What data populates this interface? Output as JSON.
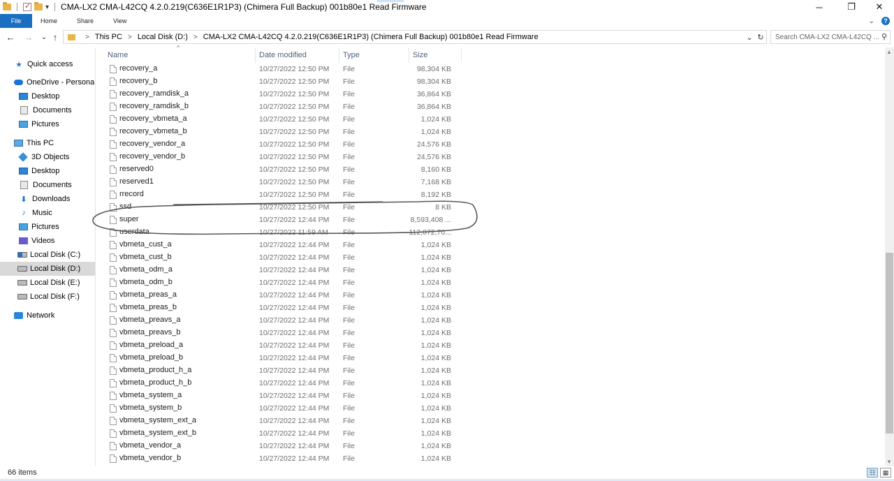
{
  "window": {
    "title": "CMA-LX2 CMA-L42CQ 4.2.0.219(C636E1R1P3) (Chimera Full Backup) 001b80e1 Read Firmware",
    "qat_dropdown": "▾",
    "minimize": "─",
    "restore": "❐",
    "close": "✕"
  },
  "ribbon": {
    "tabs": [
      "File",
      "Home",
      "Share",
      "View"
    ],
    "expand": "⌄",
    "help": "?"
  },
  "nav": {
    "back": "←",
    "forward": "→",
    "recent": "⌄",
    "up": "↑",
    "breadcrumbs": [
      "This PC",
      "Local Disk (D:)",
      "CMA-LX2 CMA-L42CQ 4.2.0.219(C636E1R1P3) (Chimera Full Backup) 001b80e1 Read Firmware"
    ],
    "crumb_sep": ">",
    "dropdown": "⌄",
    "refresh": "↻",
    "search_placeholder": "Search CMA-LX2 CMA-L42CQ ...",
    "search_icon": "⚲"
  },
  "sidebar": {
    "items": [
      {
        "label": "Quick access",
        "icon": "star-icon"
      },
      {
        "label": "OneDrive - Personal",
        "icon": "cloud-icon"
      },
      {
        "label": "Desktop",
        "icon": "desktop-icon"
      },
      {
        "label": "Documents",
        "icon": "documents-icon"
      },
      {
        "label": "Pictures",
        "icon": "pictures-icon"
      },
      {
        "label": "This PC",
        "icon": "computer-icon"
      },
      {
        "label": "3D Objects",
        "icon": "cube-icon"
      },
      {
        "label": "Desktop",
        "icon": "desktop-icon"
      },
      {
        "label": "Documents",
        "icon": "documents-icon"
      },
      {
        "label": "Downloads",
        "icon": "download-icon"
      },
      {
        "label": "Music",
        "icon": "music-icon"
      },
      {
        "label": "Pictures",
        "icon": "pictures-icon"
      },
      {
        "label": "Videos",
        "icon": "videos-icon"
      },
      {
        "label": "Local Disk (C:)",
        "icon": "drive-icon"
      },
      {
        "label": "Local Disk (D:)",
        "icon": "drive-icon"
      },
      {
        "label": "Local Disk (E:)",
        "icon": "drive-icon"
      },
      {
        "label": "Local Disk (F:)",
        "icon": "drive-icon"
      },
      {
        "label": "Network",
        "icon": "network-icon"
      }
    ],
    "selected": "Local Disk (D:)",
    "glyphs": {
      "star": "★",
      "down": "⬇",
      "music": "♪"
    }
  },
  "columns": {
    "name": "Name",
    "date": "Date modified",
    "type": "Type",
    "size": "Size",
    "sort_indicator": "^"
  },
  "files": [
    {
      "name": "recovery_a",
      "date": "10/27/2022 12:50 PM",
      "type": "File",
      "size": "98,304 KB"
    },
    {
      "name": "recovery_b",
      "date": "10/27/2022 12:50 PM",
      "type": "File",
      "size": "98,304 KB"
    },
    {
      "name": "recovery_ramdisk_a",
      "date": "10/27/2022 12:50 PM",
      "type": "File",
      "size": "36,864 KB"
    },
    {
      "name": "recovery_ramdisk_b",
      "date": "10/27/2022 12:50 PM",
      "type": "File",
      "size": "36,864 KB"
    },
    {
      "name": "recovery_vbmeta_a",
      "date": "10/27/2022 12:50 PM",
      "type": "File",
      "size": "1,024 KB"
    },
    {
      "name": "recovery_vbmeta_b",
      "date": "10/27/2022 12:50 PM",
      "type": "File",
      "size": "1,024 KB"
    },
    {
      "name": "recovery_vendor_a",
      "date": "10/27/2022 12:50 PM",
      "type": "File",
      "size": "24,576 KB"
    },
    {
      "name": "recovery_vendor_b",
      "date": "10/27/2022 12:50 PM",
      "type": "File",
      "size": "24,576 KB"
    },
    {
      "name": "reserved0",
      "date": "10/27/2022 12:50 PM",
      "type": "File",
      "size": "8,160 KB"
    },
    {
      "name": "reserved1",
      "date": "10/27/2022 12:50 PM",
      "type": "File",
      "size": "7,168 KB"
    },
    {
      "name": "rrecord",
      "date": "10/27/2022 12:50 PM",
      "type": "File",
      "size": "8,192 KB"
    },
    {
      "name": "ssd",
      "date": "10/27/2022 12:50 PM",
      "type": "File",
      "size": "8 KB"
    },
    {
      "name": "super",
      "date": "10/27/2022 12:44 PM",
      "type": "File",
      "size": "8,593,408 ..."
    },
    {
      "name": "userdata",
      "date": "10/27/2022 11:59 AM",
      "type": "File",
      "size": "112,072,70..."
    },
    {
      "name": "vbmeta_cust_a",
      "date": "10/27/2022 12:44 PM",
      "type": "File",
      "size": "1,024 KB"
    },
    {
      "name": "vbmeta_cust_b",
      "date": "10/27/2022 12:44 PM",
      "type": "File",
      "size": "1,024 KB"
    },
    {
      "name": "vbmeta_odm_a",
      "date": "10/27/2022 12:44 PM",
      "type": "File",
      "size": "1,024 KB"
    },
    {
      "name": "vbmeta_odm_b",
      "date": "10/27/2022 12:44 PM",
      "type": "File",
      "size": "1,024 KB"
    },
    {
      "name": "vbmeta_preas_a",
      "date": "10/27/2022 12:44 PM",
      "type": "File",
      "size": "1,024 KB"
    },
    {
      "name": "vbmeta_preas_b",
      "date": "10/27/2022 12:44 PM",
      "type": "File",
      "size": "1,024 KB"
    },
    {
      "name": "vbmeta_preavs_a",
      "date": "10/27/2022 12:44 PM",
      "type": "File",
      "size": "1,024 KB"
    },
    {
      "name": "vbmeta_preavs_b",
      "date": "10/27/2022 12:44 PM",
      "type": "File",
      "size": "1,024 KB"
    },
    {
      "name": "vbmeta_preload_a",
      "date": "10/27/2022 12:44 PM",
      "type": "File",
      "size": "1,024 KB"
    },
    {
      "name": "vbmeta_preload_b",
      "date": "10/27/2022 12:44 PM",
      "type": "File",
      "size": "1,024 KB"
    },
    {
      "name": "vbmeta_product_h_a",
      "date": "10/27/2022 12:44 PM",
      "type": "File",
      "size": "1,024 KB"
    },
    {
      "name": "vbmeta_product_h_b",
      "date": "10/27/2022 12:44 PM",
      "type": "File",
      "size": "1,024 KB"
    },
    {
      "name": "vbmeta_system_a",
      "date": "10/27/2022 12:44 PM",
      "type": "File",
      "size": "1,024 KB"
    },
    {
      "name": "vbmeta_system_b",
      "date": "10/27/2022 12:44 PM",
      "type": "File",
      "size": "1,024 KB"
    },
    {
      "name": "vbmeta_system_ext_a",
      "date": "10/27/2022 12:44 PM",
      "type": "File",
      "size": "1,024 KB"
    },
    {
      "name": "vbmeta_system_ext_b",
      "date": "10/27/2022 12:44 PM",
      "type": "File",
      "size": "1,024 KB"
    },
    {
      "name": "vbmeta_vendor_a",
      "date": "10/27/2022 12:44 PM",
      "type": "File",
      "size": "1,024 KB"
    },
    {
      "name": "vbmeta_vendor_b",
      "date": "10/27/2022 12:44 PM",
      "type": "File",
      "size": "1,024 KB"
    }
  ],
  "status": {
    "item_count": "66 items",
    "details_view_icon": "☷",
    "large_icons_view_icon": "▦"
  },
  "scrollbar": {
    "up": "▲",
    "down": "▼",
    "thumb_start_fraction": 0.49,
    "thumb_size_fraction": 0.45
  },
  "colors": {
    "file_tab": "#1a6fc1",
    "selected_bg": "#d9d9d9",
    "annotation_stroke": "#555555"
  }
}
